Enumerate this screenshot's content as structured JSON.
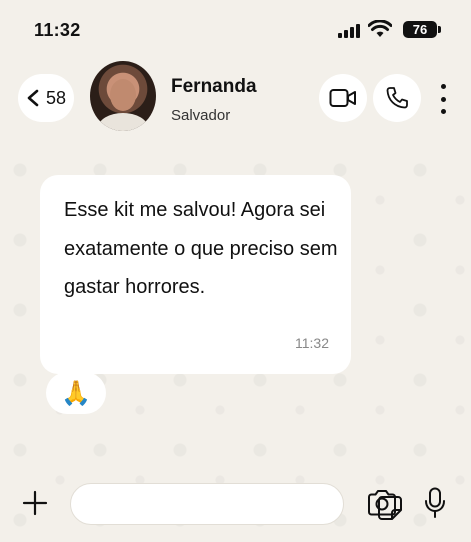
{
  "status_bar": {
    "time": "11:32",
    "battery": "76"
  },
  "header": {
    "back_count": "58",
    "contact_name": "Fernanda",
    "contact_subtitle": "Salvador"
  },
  "messages": [
    {
      "text": "Esse kit me salvou! Agora sei exatamente o que preciso sem gastar horrores.",
      "time": "11:32",
      "reaction": "🙏"
    }
  ],
  "input": {
    "placeholder": "",
    "value": ""
  },
  "icons": {
    "back": "chevron-left-icon",
    "video": "video-camera-icon",
    "call": "phone-icon",
    "more": "more-vertical-icon",
    "plus": "plus-icon",
    "sticker": "sticker-icon",
    "camera": "camera-icon",
    "mic": "microphone-icon"
  },
  "colors": {
    "background": "#f3f0ea",
    "bubble": "#ffffff",
    "timestamp": "#888888"
  }
}
